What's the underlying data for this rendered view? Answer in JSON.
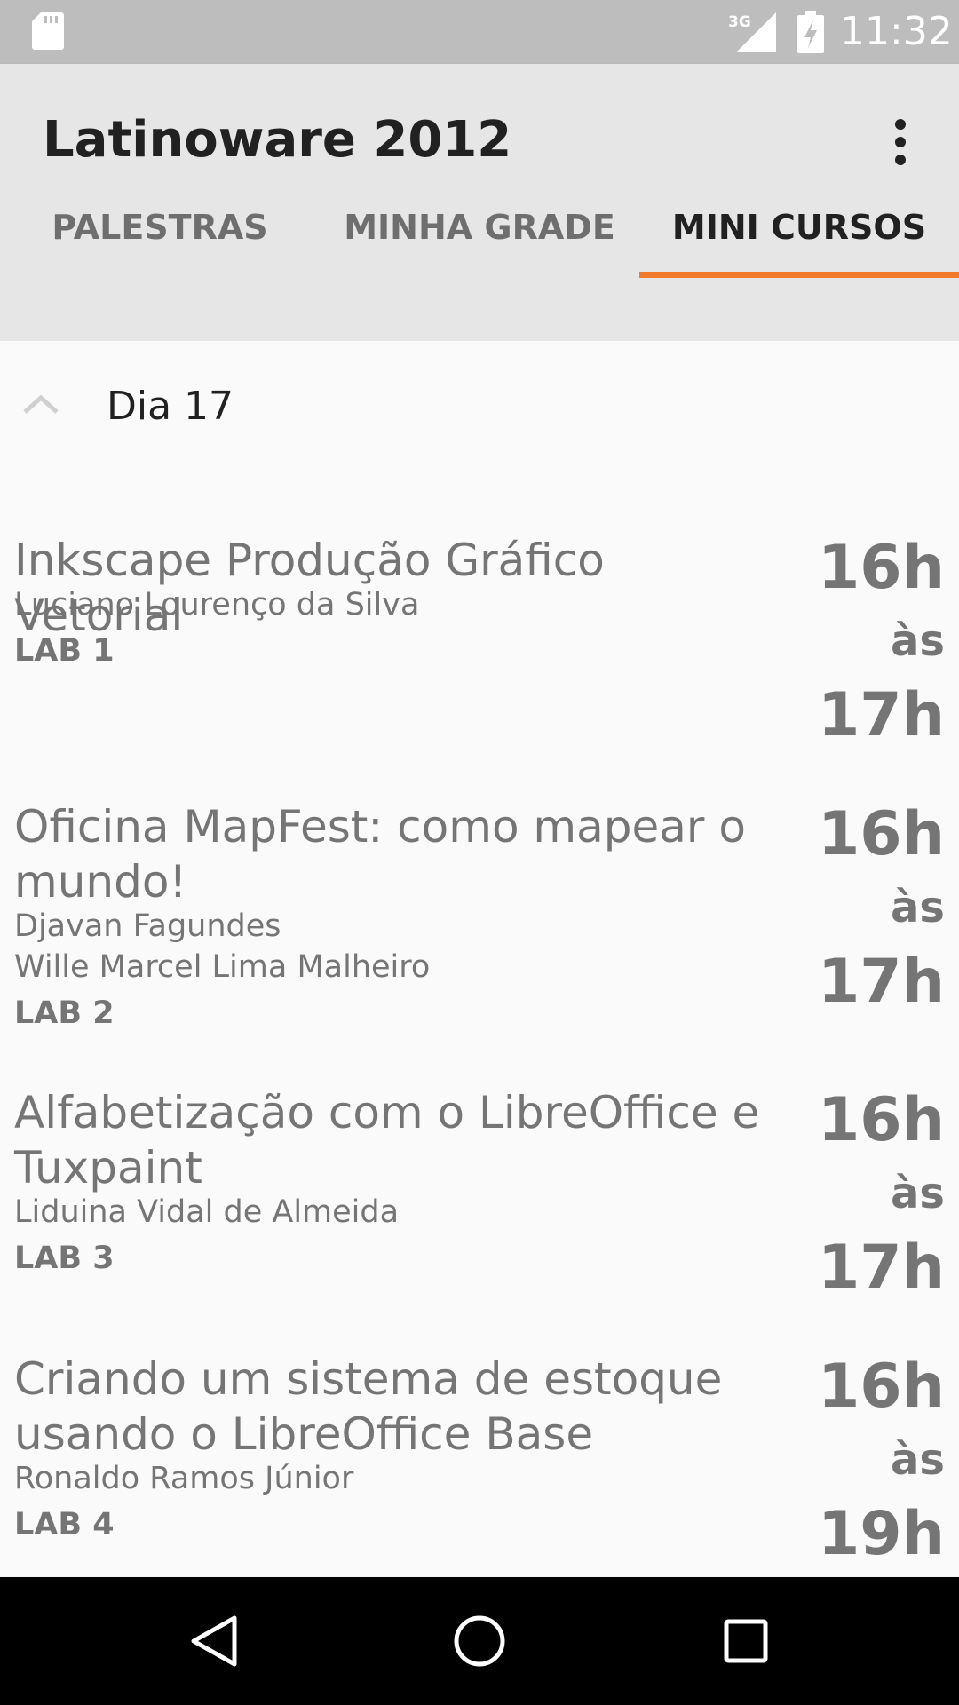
{
  "status_bar": {
    "time": "11:32",
    "network": "3G",
    "icons": [
      "sd-card-icon",
      "cell-signal-icon",
      "battery-icon"
    ]
  },
  "app_bar": {
    "title": "Latinoware 2012",
    "overflow_icon": "more-vert-icon"
  },
  "tabs": [
    {
      "label": "PALESTRAS",
      "active": false
    },
    {
      "label": "MINHA GRADE",
      "active": false
    },
    {
      "label": "MINI CURSOS",
      "active": true
    }
  ],
  "colors": {
    "accent": "#f07b2a",
    "status_bar": "#bdbdbd",
    "app_bar": "#e6e6e6",
    "background": "#fafafa",
    "text_primary": "#212121",
    "text_secondary": "#757575"
  },
  "group": {
    "title": "Dia 17",
    "expand_icon": "chevron-up-icon"
  },
  "courses": [
    {
      "title": "Inkscape Produção Gráfico Vetorial",
      "speakers": [
        "Luciano Lourenço da Silva"
      ],
      "lab": "LAB 1",
      "start": "16h",
      "sep": "às",
      "end": "17h"
    },
    {
      "title": "Oficina MapFest: como mapear o mundo!",
      "speakers": [
        "Djavan Fagundes",
        "Wille Marcel Lima Malheiro"
      ],
      "lab": "LAB 2",
      "start": "16h",
      "sep": "às",
      "end": "17h"
    },
    {
      "title": "Alfabetização com o LibreOffice e Tuxpaint",
      "speakers": [
        "Liduina Vidal de Almeida"
      ],
      "lab": "LAB 3",
      "start": "16h",
      "sep": "às",
      "end": "17h"
    },
    {
      "title": "Criando um sistema de estoque usando o LibreOffice Base",
      "speakers": [
        "Ronaldo Ramos Júnior"
      ],
      "lab": "LAB 4",
      "start": "16h",
      "sep": "às",
      "end": "19h"
    }
  ],
  "nav_bar": {
    "buttons": [
      "back-icon",
      "home-icon",
      "recents-icon"
    ]
  }
}
